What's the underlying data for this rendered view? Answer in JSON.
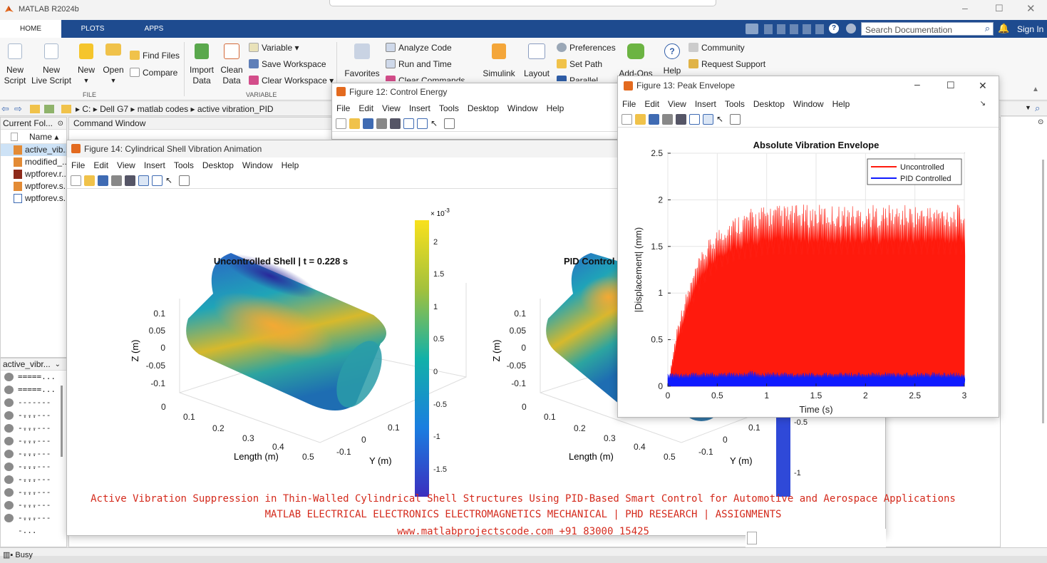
{
  "app": {
    "title": "MATLAB R2024b"
  },
  "tabs": [
    "HOME",
    "PLOTS",
    "APPS"
  ],
  "search": {
    "placeholder": "Search Documentation",
    "sign_in": "Sign In"
  },
  "ribbon": {
    "file": {
      "new_script": "New\nScript",
      "new_live_script": "New\nLive Script",
      "new": "New",
      "open": "Open",
      "find_files": "Find Files",
      "compare": "Compare",
      "group": "FILE"
    },
    "variable": {
      "import_data": "Import\nData",
      "clean_data": "Clean\nData",
      "variable": "Variable",
      "save_workspace": "Save Workspace",
      "clear_workspace": "Clear Workspace",
      "group": "VARIABLE"
    },
    "code": {
      "favorites": "Favorites",
      "analyze_code": "Analyze Code",
      "run_and_time": "Run and Time",
      "clear_commands": "Clear Commands"
    },
    "simulink": "Simulink",
    "layout": "Layout",
    "preferences": "Preferences",
    "set_path": "Set Path",
    "parallel": "Parallel",
    "add_ons": "Add-Ons",
    "help": "Help",
    "community": "Community",
    "request_support": "Request Support"
  },
  "path": {
    "segments": [
      "C:",
      "Dell G7",
      "matlab codes",
      "active vibration_PID"
    ]
  },
  "current_folder": {
    "header": "Current Fol...",
    "col": "Name",
    "files": [
      "active_vib...",
      "modified_...",
      "wptforev.r...",
      "wptforev.s...",
      "wptforev.s..."
    ]
  },
  "command_window": {
    "header": "Command Window"
  },
  "history": {
    "header": "active_vibr...",
    "items": [
      "=====...",
      "=====...",
      "--------...",
      "--------...",
      "--------...",
      "--------...",
      "--------...",
      "--------...",
      "--------...",
      "--------...",
      "--------...",
      "--------..."
    ]
  },
  "status": {
    "text": "Busy"
  },
  "menus": [
    "File",
    "Edit",
    "View",
    "Insert",
    "Tools",
    "Desktop",
    "Window",
    "Help"
  ],
  "fig12": {
    "title": "Figure 12: Control Energy"
  },
  "fig14": {
    "title": "Figure 14: Cylindrical Shell Vibration Animation",
    "left_title": "Uncontrolled Shell  |  t = 0.228 s",
    "right_title": "PID Control",
    "zlabel": "Z (m)",
    "xlabel": "Length (m)",
    "ylabel": "Y (m)",
    "zticks": [
      "0.1",
      "0.05",
      "0",
      "-0.05",
      "-0.1"
    ],
    "xticks": [
      "0",
      "0.1",
      "0.2",
      "0.3",
      "0.4",
      "0.5"
    ],
    "yticks": [
      "0.1",
      "0",
      "-0.1"
    ],
    "colorbar": {
      "exp": "× 10",
      "exp_power": "-3",
      "ticks": [
        "2",
        "1.5",
        "1",
        "0.5",
        "0",
        "-0.5",
        "-1",
        "-1.5"
      ]
    },
    "colorbar2_ticks": [
      "-0.5",
      "-1"
    ]
  },
  "fig13": {
    "title": "Figure 13: Peak Envelope"
  },
  "chart_data": {
    "type": "area",
    "title": "Absolute Vibration Envelope",
    "xlabel": "Time (s)",
    "ylabel": "|Displacement| (mm)",
    "xlim": [
      0,
      3
    ],
    "ylim": [
      0,
      2.5
    ],
    "xticks": [
      "0",
      "0.5",
      "1",
      "1.5",
      "2",
      "2.5",
      "3"
    ],
    "yticks": [
      "0",
      "0.5",
      "1",
      "1.5",
      "2",
      "2.5"
    ],
    "legend": "top-right",
    "grid": true,
    "series": [
      {
        "name": "Uncontrolled",
        "color": "#ff1a0d",
        "x": [
          0,
          0.1,
          0.2,
          0.3,
          0.4,
          0.5,
          0.6,
          0.7,
          0.8,
          1,
          1.5,
          2,
          2.5,
          3
        ],
        "envelope_max": [
          0,
          0.7,
          1.05,
          1.35,
          1.55,
          1.7,
          1.8,
          1.85,
          1.9,
          1.95,
          1.95,
          1.95,
          1.95,
          1.95
        ],
        "envelope_min": [
          0,
          0.45,
          0.75,
          1.0,
          1.15,
          1.25,
          1.3,
          1.35,
          1.35,
          1.4,
          1.4,
          1.4,
          1.4,
          1.4
        ]
      },
      {
        "name": "PID Controlled",
        "color": "#0f1aff",
        "x": [
          0,
          0.5,
          0.82,
          0.85,
          0.9,
          1.5,
          2,
          2.5,
          3
        ],
        "envelope_max": [
          0.15,
          0.15,
          0.15,
          0.22,
          0.15,
          0.15,
          0.15,
          0.15,
          0.15
        ],
        "envelope_min": [
          0.06,
          0.07,
          0.07,
          0.07,
          0.07,
          0.07,
          0.07,
          0.07,
          0.07
        ]
      }
    ]
  },
  "watermark": {
    "line1": "Active Vibration Suppression in Thin-Walled Cylindrical Shell Structures Using PID-Based Smart Control for Automotive and Aerospace Applications",
    "line2": "MATLAB ELECTRICAL ELECTRONICS ELECTROMAGNETICS MECHANICAL | PHD RESEARCH | ASSIGNMENTS",
    "line3": "www.matlabprojectscode.com +91 83000 15425"
  },
  "colors": {
    "tabbar": "#1e4b8f",
    "accent": "#d42a1c"
  }
}
